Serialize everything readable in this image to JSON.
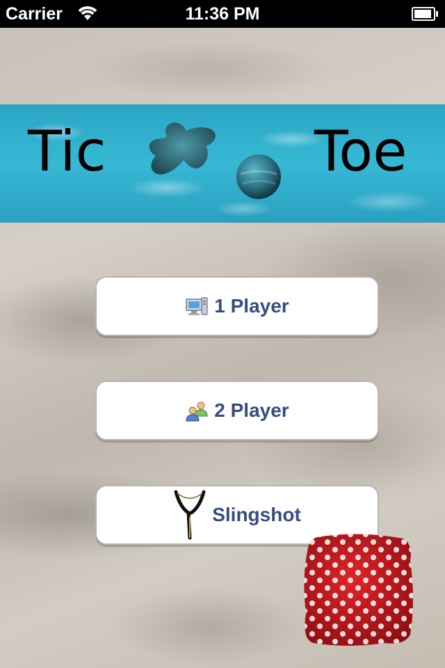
{
  "status_bar": {
    "carrier": "Carrier",
    "time": "11:36 PM"
  },
  "title": {
    "left_word": "Tic",
    "right_word": "Toe"
  },
  "menu": {
    "one_player": {
      "label": "1 Player",
      "icon": "computer-icon"
    },
    "two_player": {
      "label": "2 Player",
      "icon": "users-icon"
    },
    "slingshot": {
      "label": "Slingshot",
      "icon": "slingshot-icon"
    }
  },
  "colors": {
    "button_text": "#354e80",
    "water": "#36b8d4",
    "beanbag": "#c8181c"
  }
}
